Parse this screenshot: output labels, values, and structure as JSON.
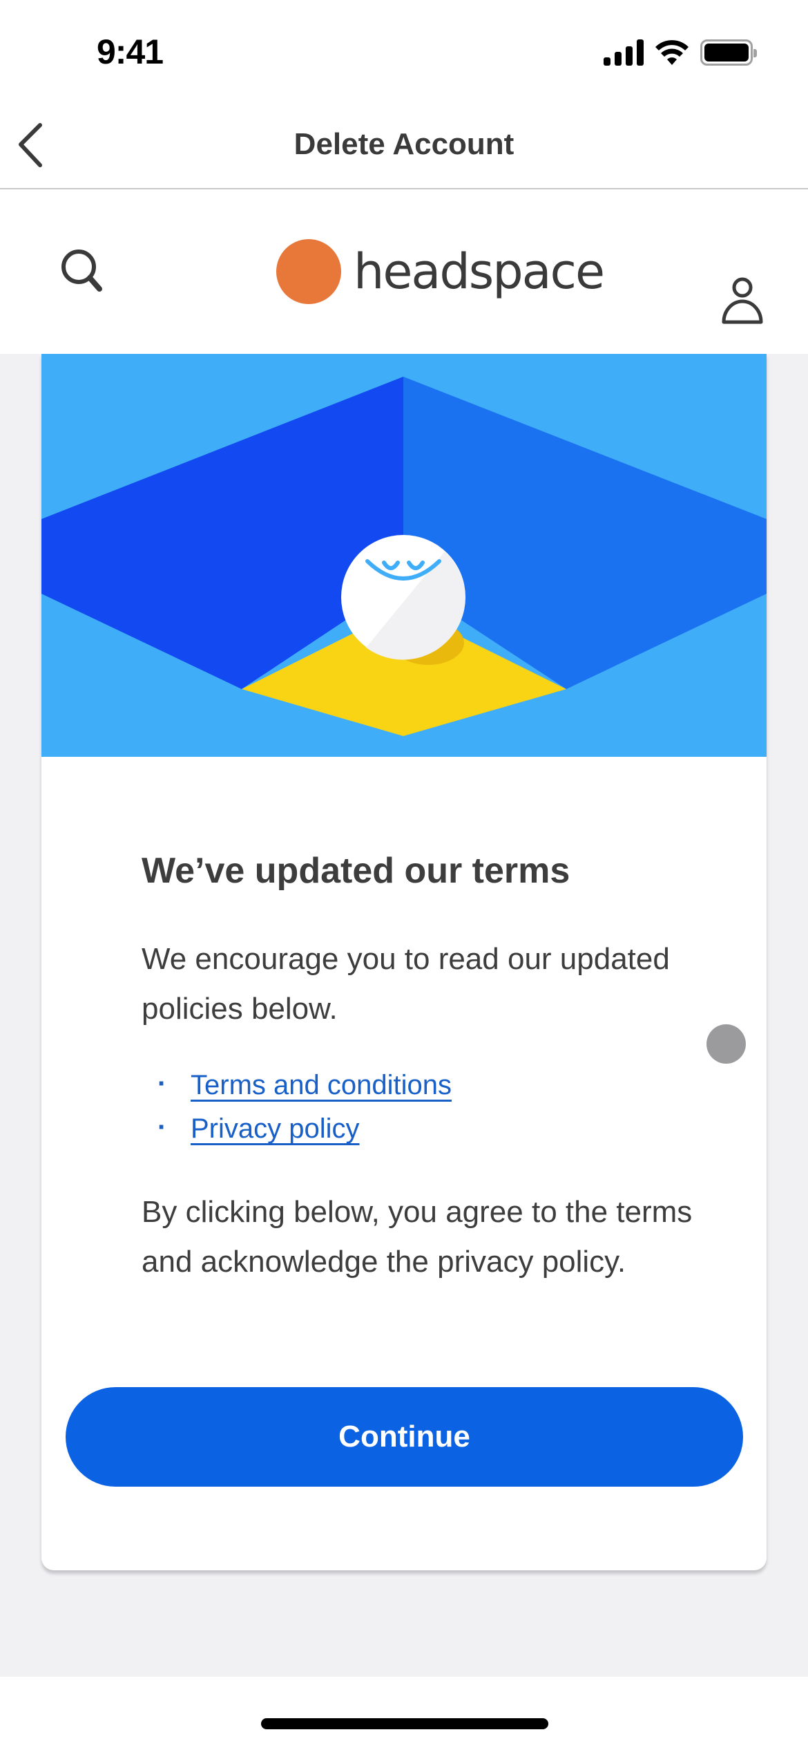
{
  "status_bar": {
    "time": "9:41",
    "icons": [
      "cellular-signal-icon",
      "wifi-icon",
      "battery-icon"
    ]
  },
  "nav_bar": {
    "back_icon": "chevron-left-icon",
    "title": "Delete Account"
  },
  "site_header": {
    "search_icon": "search-icon",
    "logo_text": "headspace",
    "profile_icon": "person-icon"
  },
  "colors": {
    "brand_orange": "#e8773a",
    "hero_light_blue": "#40adf8",
    "hero_dark_blue": "#1249f0",
    "hero_mid_blue": "#1a72f0",
    "hero_yellow": "#f8d414",
    "link_blue": "#1860c8",
    "button_blue": "#0b62e2",
    "page_bg": "#f1f0f3",
    "text": "#3d3d3d"
  },
  "card": {
    "illustration": "headspace-smiling-character-illustration",
    "title": "We’ve updated our terms",
    "body_intro": "We encourage you to read our updated policies below.",
    "links": [
      {
        "label": "Terms and conditions"
      },
      {
        "label": "Privacy policy"
      }
    ],
    "body_agreement": "By clicking below, you agree to the terms and acknowledge the privacy policy.",
    "continue_label": "Continue"
  }
}
